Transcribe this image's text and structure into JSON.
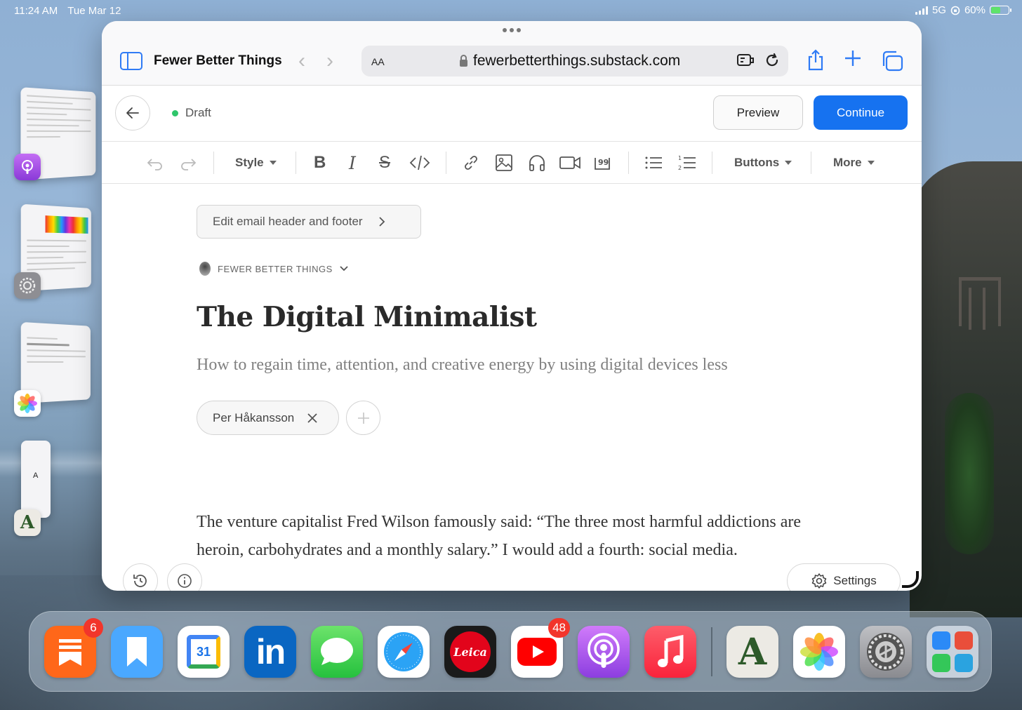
{
  "status_bar": {
    "time": "11:24 AM",
    "date": "Tue Mar 12",
    "network": "5G",
    "battery": "60%",
    "battery_level": 0.6
  },
  "safari": {
    "site_title": "Fewer Better Things",
    "aa_label": "AA",
    "url": "fewerbetterthings.substack.com"
  },
  "editor": {
    "draft_label": "Draft",
    "preview_label": "Preview",
    "continue_label": "Continue",
    "toolbar": {
      "style_label": "Style",
      "buttons_label": "Buttons",
      "more_label": "More"
    },
    "email_header_footer_label": "Edit email header and footer",
    "publication_name": "FEWER BETTER THINGS",
    "title": "The Digital Minimalist",
    "subtitle": "How to regain time, attention, and creative energy by using digital devices less",
    "author": "Per Håkansson",
    "body": "The venture capitalist Fred Wilson famously said: “The three most harmful addictions are heroin, carbohydrates and a monthly salary.” I would add a fourth: social media.",
    "settings_label": "Settings"
  },
  "stage_manager": {
    "text_app_label": "A"
  },
  "dock": {
    "substack_badge": "6",
    "calendar_day": "31",
    "youtube_badge": "48",
    "linkedin_label": "in",
    "leica_label": "Leica",
    "mini_app_label": "A",
    "colors": {
      "substack": "#ff6719",
      "bookmarks": "#4aa8ff",
      "linkedin": "#0a66c2",
      "messages": "#34c759",
      "leica": "#1a1a1a",
      "podcasts": "#9b4ee2",
      "music": "#fc3c44"
    }
  }
}
